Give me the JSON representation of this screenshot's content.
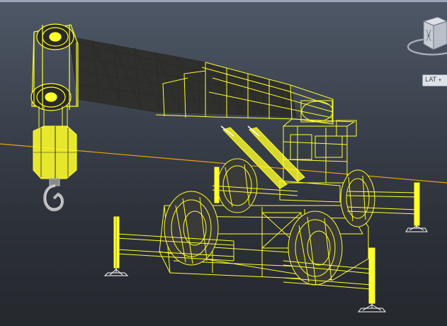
{
  "viewport": {
    "projection_label": "LAT",
    "projection_chevron": "▾",
    "viewcube_icon": "viewcube-icon",
    "compass_ring_icon": "compass-ring-icon"
  },
  "colors": {
    "wireframe": "#ffff2a",
    "wireframe_dark": "#2a2a26",
    "ground_line": "#e8a20a",
    "background_top": "#4f5867",
    "background_bottom": "#25282d"
  }
}
